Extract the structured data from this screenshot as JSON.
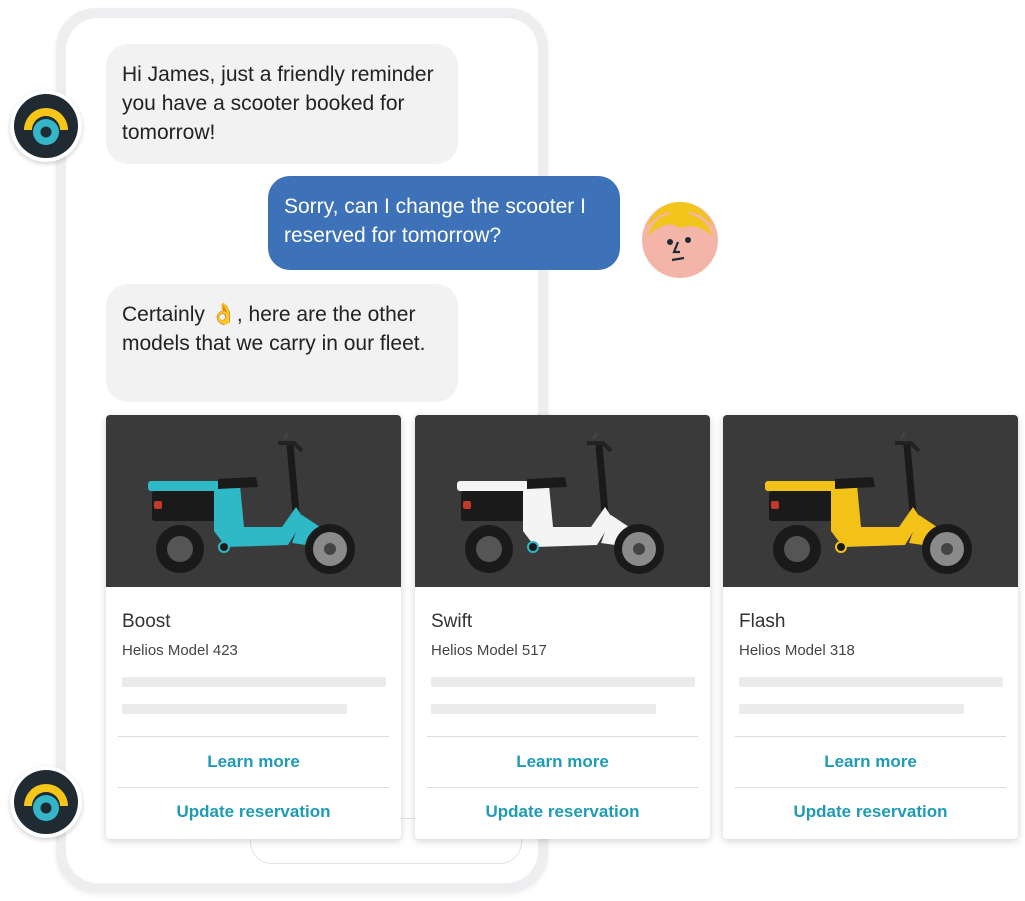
{
  "chat": {
    "bot_message_1": "Hi James, just a friendly reminder you have a scooter booked for tomorrow!",
    "user_message": "Sorry, can I change the scooter I reserved for tomorrow?",
    "bot_message_2_before": "Certainly ",
    "bot_message_2_emoji": "👌",
    "bot_message_2_after": ", here are the other models that we carry in our fleet."
  },
  "cards": [
    {
      "name": "Boost",
      "model": "Helios Model 423",
      "color": "#2fb8c6",
      "learn_more": "Learn more",
      "update": "Update reservation"
    },
    {
      "name": "Swift",
      "model": "Helios Model 517",
      "color": "#f4f4f4",
      "learn_more": "Learn more",
      "update": "Update reservation"
    },
    {
      "name": "Flash",
      "model": "Helios Model 318",
      "color": "#f2c218",
      "learn_more": "Learn more",
      "update": "Update reservation"
    }
  ],
  "colors": {
    "accent": "#1f9bb5",
    "user_bubble": "#3d72b8",
    "bot_bubble": "#f2f2f3",
    "bot_avatar_yellow": "#f5c518",
    "bot_avatar_teal": "#35b6c8"
  },
  "icons": {
    "bot_avatar": "bot-logo-icon",
    "user_avatar": "user-avatar-icon",
    "emoji": "ok-hand-icon"
  }
}
